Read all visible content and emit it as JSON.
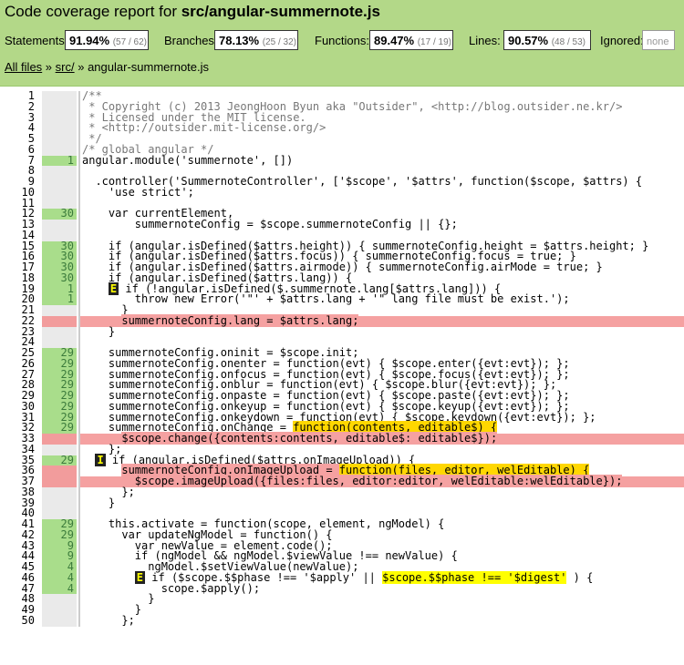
{
  "page": {
    "title_prefix": "Code coverage report for ",
    "title_file": "src/angular-summernote.js"
  },
  "stats": [
    {
      "label": "Statements:",
      "pct": "91.94%",
      "frac": "(57 / 62)"
    },
    {
      "label": "Branches:",
      "pct": "78.13%",
      "frac": "(25 / 32)"
    },
    {
      "label": "Functions:",
      "pct": "89.47%",
      "frac": "(17 / 19)"
    },
    {
      "label": "Lines:",
      "pct": "90.57%",
      "frac": "(48 / 53)"
    },
    {
      "label": "Ignored:",
      "pct": "",
      "frac": "none"
    }
  ],
  "breadcrumb": {
    "all_files": "All files",
    "sep1": " » ",
    "dir": "src/",
    "sep2": " » ",
    "file": "angular-summernote.js"
  },
  "colors": {
    "header_bg": "#b3d888",
    "covered": "#a9dd8b",
    "uncovered": "#f5a1a1",
    "branch_highlight": "#ffd700",
    "cond_highlight": "#ffff00"
  },
  "lines": [
    {
      "n": "1",
      "count": "",
      "code": "/**",
      "kind": "comment"
    },
    {
      "n": "2",
      "count": "",
      "code": " * Copyright (c) 2013 JeongHoon Byun aka \"Outsider\", <http://blog.outsider.ne.kr/>",
      "kind": "comment"
    },
    {
      "n": "3",
      "count": "",
      "code": " * Licensed under the MIT license.",
      "kind": "comment"
    },
    {
      "n": "4",
      "count": "",
      "code": " * <http://outsider.mit-license.org/>",
      "kind": "comment"
    },
    {
      "n": "5",
      "count": "",
      "code": " */",
      "kind": "comment"
    },
    {
      "n": "6",
      "count": "",
      "code": "/* global angular */",
      "kind": "comment"
    },
    {
      "n": "7",
      "count": "1",
      "code": "angular.module('summernote', [])",
      "kind": "hit"
    },
    {
      "n": "8",
      "count": "",
      "code": "",
      "kind": ""
    },
    {
      "n": "9",
      "count": "",
      "code": "  .controller('SummernoteController', ['$scope', '$attrs', function($scope, $attrs) {",
      "kind": ""
    },
    {
      "n": "10",
      "count": "",
      "code": "    'use strict';",
      "kind": ""
    },
    {
      "n": "11",
      "count": "",
      "code": "",
      "kind": ""
    },
    {
      "n": "12",
      "count": "30",
      "code": "    var currentElement,",
      "kind": "hit"
    },
    {
      "n": "13",
      "count": "",
      "code": "        summernoteConfig = $scope.summernoteConfig || {};",
      "kind": ""
    },
    {
      "n": "14",
      "count": "",
      "code": "",
      "kind": ""
    },
    {
      "n": "15",
      "count": "30",
      "code": "    if (angular.isDefined($attrs.height)) { summernoteConfig.height = $attrs.height; }",
      "kind": "hit"
    },
    {
      "n": "16",
      "count": "30",
      "code": "    if (angular.isDefined($attrs.focus)) { summernoteConfig.focus = true; }",
      "kind": "hit"
    },
    {
      "n": "17",
      "count": "30",
      "code": "    if (angular.isDefined($attrs.airmode)) { summernoteConfig.airMode = true; }",
      "kind": "hit"
    },
    {
      "n": "18",
      "count": "30",
      "code": "    if (angular.isDefined($attrs.lang)) {",
      "kind": "hit"
    },
    {
      "n": "19",
      "count": "1",
      "code": "      if (!angular.isDefined($.summernote.lang[$attrs.lang])) {",
      "kind": "hit",
      "mark": "E"
    },
    {
      "n": "20",
      "count": "1",
      "code": "        throw new Error('\"' + $attrs.lang + '\" lang file must be exist.');",
      "kind": "hit"
    },
    {
      "n": "21",
      "count": "",
      "code": "      }",
      "kind": ""
    },
    {
      "n": "22",
      "count": "",
      "code": "      summernoteConfig.lang = $attrs.lang;",
      "kind": "miss"
    },
    {
      "n": "23",
      "count": "",
      "code": "    }",
      "kind": ""
    },
    {
      "n": "24",
      "count": "",
      "code": "",
      "kind": ""
    },
    {
      "n": "25",
      "count": "29",
      "code": "    summernoteConfig.oninit = $scope.init;",
      "kind": "hit"
    },
    {
      "n": "26",
      "count": "29",
      "code": "    summernoteConfig.onenter = function(evt) { $scope.enter({evt:evt}); };",
      "kind": "hit"
    },
    {
      "n": "27",
      "count": "29",
      "code": "    summernoteConfig.onfocus = function(evt) { $scope.focus({evt:evt}); };",
      "kind": "hit"
    },
    {
      "n": "28",
      "count": "29",
      "code": "    summernoteConfig.onblur = function(evt) { $scope.blur({evt:evt}); };",
      "kind": "hit"
    },
    {
      "n": "29",
      "count": "29",
      "code": "    summernoteConfig.onpaste = function(evt) { $scope.paste({evt:evt}); };",
      "kind": "hit"
    },
    {
      "n": "30",
      "count": "29",
      "code": "    summernoteConfig.onkeyup = function(evt) { $scope.keyup({evt:evt}); };",
      "kind": "hit"
    },
    {
      "n": "31",
      "count": "29",
      "code": "    summernoteConfig.onkeydown = function(evt) { $scope.keydown({evt:evt}); };",
      "kind": "hit"
    },
    {
      "n": "32",
      "count": "29",
      "code": "    summernoteConfig.onChange = ",
      "kind": "hit",
      "hl": "function(contents, editable$) {",
      "hlclass": "hl-y"
    },
    {
      "n": "33",
      "count": "",
      "code": "      $scope.change({contents:contents, editable$: editable$});",
      "kind": "miss"
    },
    {
      "n": "34",
      "count": "",
      "code": "    };",
      "kind": ""
    },
    {
      "n": "35",
      "count": "29",
      "code": "    if (angular.isDefined($attrs.onImageUpload)) {",
      "kind": "hit",
      "mark": "I"
    },
    {
      "n": "36",
      "count": "",
      "code": "      summernoteConfig.onImageUpload = ",
      "kind": "miss",
      "hl": "function(files, editor, welEditable) {",
      "hlclass": "hl-y"
    },
    {
      "n": "37",
      "count": "",
      "code": "        $scope.imageUpload({files:files, editor:editor, welEditable:welEditable});",
      "kind": "miss"
    },
    {
      "n": "38",
      "count": "",
      "code": "      };",
      "kind": ""
    },
    {
      "n": "39",
      "count": "",
      "code": "    }",
      "kind": ""
    },
    {
      "n": "40",
      "count": "",
      "code": "",
      "kind": ""
    },
    {
      "n": "41",
      "count": "29",
      "code": "    this.activate = function(scope, element, ngModel) {",
      "kind": "hit"
    },
    {
      "n": "42",
      "count": "29",
      "code": "      var updateNgModel = function() {",
      "kind": "hit"
    },
    {
      "n": "43",
      "count": "9",
      "code": "        var newValue = element.code();",
      "kind": "hit"
    },
    {
      "n": "44",
      "count": "9",
      "code": "        if (ngModel && ngModel.$viewValue !== newValue) {",
      "kind": "hit"
    },
    {
      "n": "45",
      "count": "4",
      "code": "          ngModel.$setViewValue(newValue);",
      "kind": "hit"
    },
    {
      "n": "46",
      "count": "4",
      "code": "          if ($scope.$$phase !== '$apply' || ",
      "kind": "hit",
      "mark": "E",
      "hl": "$scope.$$phase !== '$digest'",
      "hlclass": "hl-g",
      "tail": " ) {"
    },
    {
      "n": "47",
      "count": "4",
      "code": "            scope.$apply();",
      "kind": "hit"
    },
    {
      "n": "48",
      "count": "",
      "code": "          }",
      "kind": ""
    },
    {
      "n": "49",
      "count": "",
      "code": "        }",
      "kind": ""
    },
    {
      "n": "50",
      "count": "",
      "code": "      };",
      "kind": ""
    }
  ]
}
